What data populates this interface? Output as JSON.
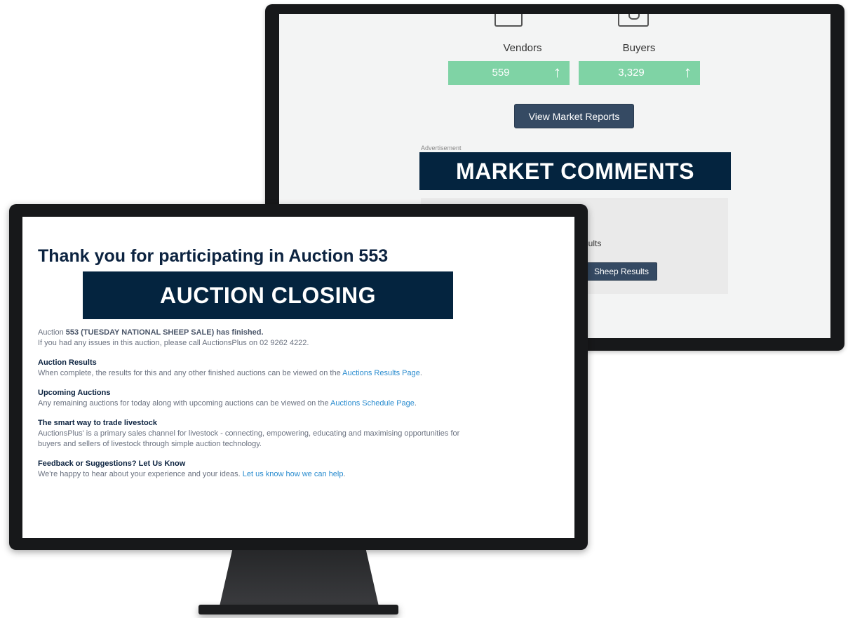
{
  "back_screen": {
    "stats": [
      {
        "label": "Vendors",
        "value": "559",
        "arrow": "↑"
      },
      {
        "label": "Buyers",
        "value": "3,329",
        "arrow": "↑"
      }
    ],
    "view_reports_label": "View Market Reports",
    "ad_label": "Advertisement",
    "market_banner": "MARKET COMMENTS",
    "results_text": "esults",
    "sheep_results_label": "Sheep Results"
  },
  "front_screen": {
    "title": "Thank you for participating in Auction 553",
    "closing_banner": "AUCTION CLOSING",
    "intro": {
      "prefix": "Auction ",
      "bold": "553 (TUESDAY NATIONAL SHEEP SALE) has finished.",
      "line2": "If you had any issues in this auction, please call AuctionsPlus on 02 9262 4222."
    },
    "results": {
      "heading": "Auction Results",
      "text": "When complete, the results for this and any other finished auctions can be viewed on the ",
      "link": "Auctions Results Page",
      "suffix": "."
    },
    "upcoming": {
      "heading": "Upcoming Auctions",
      "text": "Any remaining auctions for today along with upcoming auctions can be viewed on the ",
      "link": "Auctions Schedule Page",
      "suffix": "."
    },
    "smart": {
      "heading": "The smart way to trade livestock",
      "line1": "AuctionsPlus' is a primary sales channel for livestock - connecting, empowering, educating and maximising opportunities for",
      "line2": "buyers and sellers of livestock through simple auction technology."
    },
    "feedback": {
      "heading": "Feedback or Suggestions? Let Us Know",
      "text": "We're happy to hear about your experience and your ideas. ",
      "link": "Let us know how we can help",
      "suffix": "."
    }
  },
  "colors": {
    "navy": "#04243f",
    "green": "#7fd3a5",
    "button": "#354a63",
    "link": "#2a8ccf"
  }
}
